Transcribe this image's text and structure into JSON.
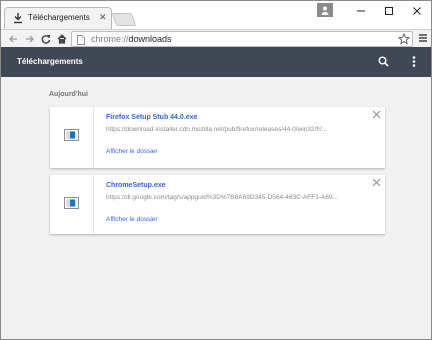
{
  "browser": {
    "tab": {
      "title": "Téléchargements",
      "icon": "download-icon"
    },
    "address_bar": {
      "scheme": "chrome://",
      "path": "downloads"
    }
  },
  "header": {
    "title": "Téléchargements"
  },
  "downloads": {
    "date_label": "Aujourd'hui",
    "items": [
      {
        "file_name": "Firefox Setup Stub 44.0.exe",
        "url": "https://download-installer.cdn.mozilla.net/pub/firefox/releases/44.0/win32/fr/...",
        "show_folder_label": "Afficher le dossier"
      },
      {
        "file_name": "ChromeSetup.exe",
        "url": "https://dl.google.com/tag/s/appguid%3D%7B8A69D345-D564-463C-AFF1-A69...",
        "show_folder_label": "Afficher le dossier"
      }
    ]
  },
  "colors": {
    "header_bg": "#3e4955",
    "link": "#3367d6",
    "page_bg": "#f1f1f1"
  }
}
